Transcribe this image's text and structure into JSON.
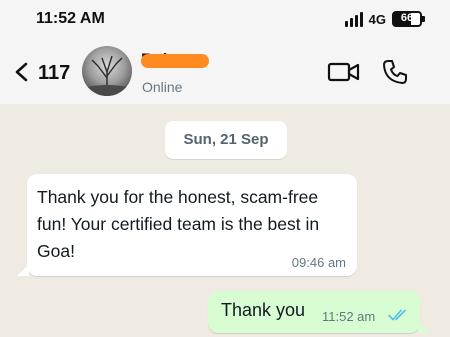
{
  "status_bar": {
    "time": "11:52 AM",
    "network": "4G",
    "battery_level": "66",
    "battery_fraction": 0.66
  },
  "header": {
    "unread_count": "117",
    "contact_name": "Balram",
    "presence": "Online",
    "icons": [
      "chevron-left-icon",
      "video-call-icon",
      "phone-icon"
    ]
  },
  "chat": {
    "date_separator": "Sun, 21 Sep",
    "messages": [
      {
        "direction": "incoming",
        "text": " Thank you for the honest, scam-free fun! Your certified team is the best in Goa!",
        "time": "09:46 am"
      },
      {
        "direction": "outgoing",
        "text": "Thank you",
        "time": "11:52 am",
        "status": "read",
        "status_color": "#53bdeb"
      }
    ]
  },
  "colors": {
    "background": "#efeae2",
    "outgoing_bubble": "#d9fdd3",
    "incoming_bubble": "#ffffff",
    "name_redaction": "#ff8a1f"
  }
}
